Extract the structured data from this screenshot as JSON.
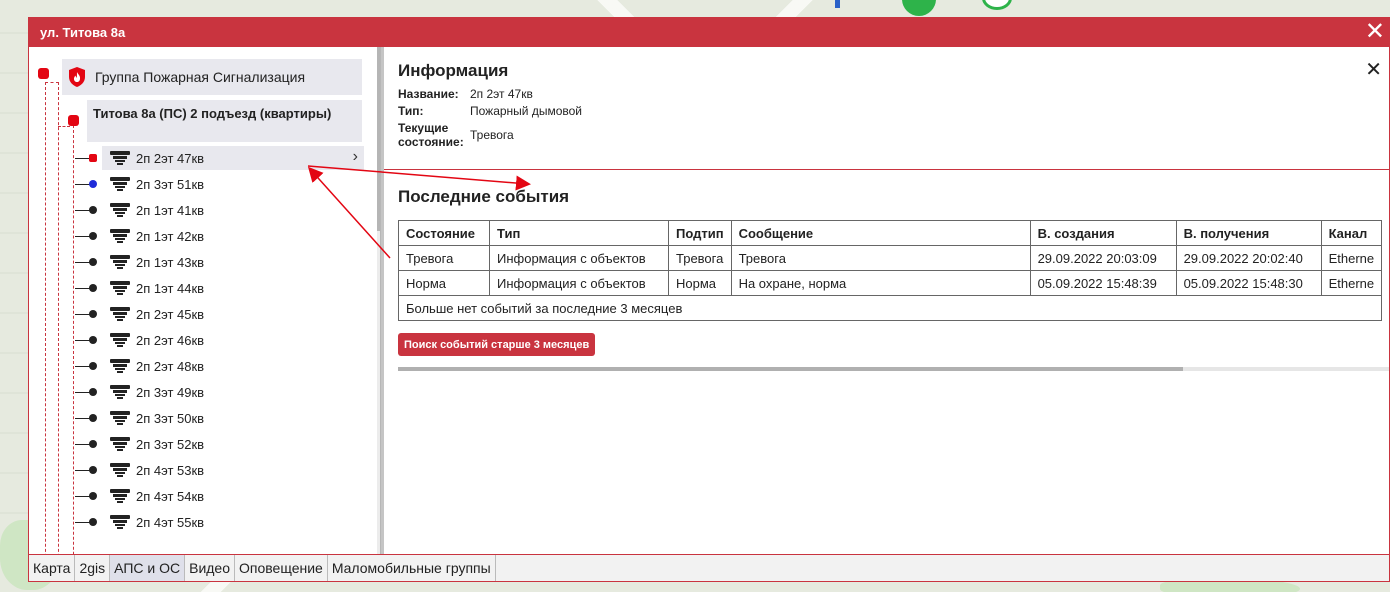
{
  "window": {
    "title": "ул. Титова 8а"
  },
  "tree": {
    "group_label": "Группа Пожарная Сигнализация",
    "sub_label": "Титова 8а (ПС) 2 подъезд (квартиры)",
    "items": [
      {
        "label": "2п 2эт 47кв",
        "state": "red",
        "selected": true
      },
      {
        "label": "2п 3эт 51кв",
        "state": "blue",
        "selected": false
      },
      {
        "label": "2п 1эт 41кв",
        "state": "black",
        "selected": false
      },
      {
        "label": "2п 1эт 42кв",
        "state": "black",
        "selected": false
      },
      {
        "label": "2п 1эт 43кв",
        "state": "black",
        "selected": false
      },
      {
        "label": "2п 1эт 44кв",
        "state": "black",
        "selected": false
      },
      {
        "label": "2п 2эт 45кв",
        "state": "black",
        "selected": false
      },
      {
        "label": "2п 2эт 46кв",
        "state": "black",
        "selected": false
      },
      {
        "label": "2п 2эт 48кв",
        "state": "black",
        "selected": false
      },
      {
        "label": "2п 3эт 49кв",
        "state": "black",
        "selected": false
      },
      {
        "label": "2п 3эт 50кв",
        "state": "black",
        "selected": false
      },
      {
        "label": "2п 3эт 52кв",
        "state": "black",
        "selected": false
      },
      {
        "label": "2п 4эт 53кв",
        "state": "black",
        "selected": false
      },
      {
        "label": "2п 4эт 54кв",
        "state": "black",
        "selected": false
      },
      {
        "label": "2п 4эт 55кв",
        "state": "black",
        "selected": false
      }
    ]
  },
  "info": {
    "title": "Информация",
    "name_key": "Название:",
    "name_value": "2п 2эт 47кв",
    "type_key": "Тип:",
    "type_value": "Пожарный дымовой",
    "state_key": "Текущие состояние:",
    "state_value": "Тревога"
  },
  "events": {
    "title": "Последние события",
    "columns": [
      "Состояние",
      "Тип",
      "Подтип",
      "Сообщение",
      "В. создания",
      "В. получения",
      "Канал"
    ],
    "rows": [
      [
        "Тревога",
        "Информация с объектов",
        "Тревога",
        "Тревога",
        "29.09.2022 20:03:09",
        "29.09.2022 20:02:40",
        "Etherne"
      ],
      [
        "Норма",
        "Информация с объектов",
        "Норма",
        "На охране, норма",
        "05.09.2022 15:48:39",
        "05.09.2022 15:48:30",
        "Etherne"
      ]
    ],
    "no_more": "Больше нет событий за последние 3 месяцев",
    "search_button": "Поиск событий старше 3 месяцев"
  },
  "tabs": [
    "Карта",
    "2gis",
    "АПС и ОС",
    "Видео",
    "Оповещение",
    "Маломобильные группы"
  ],
  "active_tab": "АПС и ОС",
  "colors": {
    "accent": "#c9343f",
    "alarm": "#e30613",
    "blue_state": "#1f2bd8"
  }
}
